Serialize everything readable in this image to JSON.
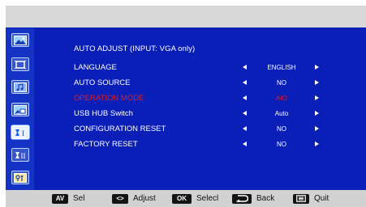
{
  "menu": {
    "heading": "AUTO ADJUST (INPUT: VGA only)",
    "rows": [
      {
        "label": "LANGUAGE",
        "value": "ENGLISH"
      },
      {
        "label": "AUTO SOURCE",
        "value": "NO"
      },
      {
        "label": "OPERATION MODE",
        "value": "AIO"
      },
      {
        "label": "USB HUB Switch",
        "value": "Auto"
      },
      {
        "label": "CONFIGURATION RESET",
        "value": "NO"
      },
      {
        "label": "FACTORY RESET",
        "value": "NO"
      }
    ]
  },
  "sidebar": {
    "items": [
      {
        "icon": "picture-icon"
      },
      {
        "icon": "screen-icon"
      },
      {
        "icon": "audio-icon"
      },
      {
        "icon": "pip-icon"
      },
      {
        "icon": "configuration-1-icon",
        "active": true
      },
      {
        "icon": "configuration-2-icon"
      },
      {
        "icon": "advanced-option-icon"
      }
    ]
  },
  "hints": [
    {
      "key": "AV",
      "label": "Sel",
      "icon": "up-down-key-icon"
    },
    {
      "key": "<>",
      "label": "Adjust",
      "icon": "left-right-key-icon"
    },
    {
      "key": "OK",
      "label": "Selecl"
    },
    {
      "key": "",
      "label": "Back",
      "icon": "return-key-icon"
    },
    {
      "key": "",
      "label": "Quit",
      "icon": "menu-key-icon"
    }
  ],
  "colors": {
    "background": "#0a1fb8",
    "highlight": "#d8202a",
    "bar": "#d2d2d2"
  }
}
